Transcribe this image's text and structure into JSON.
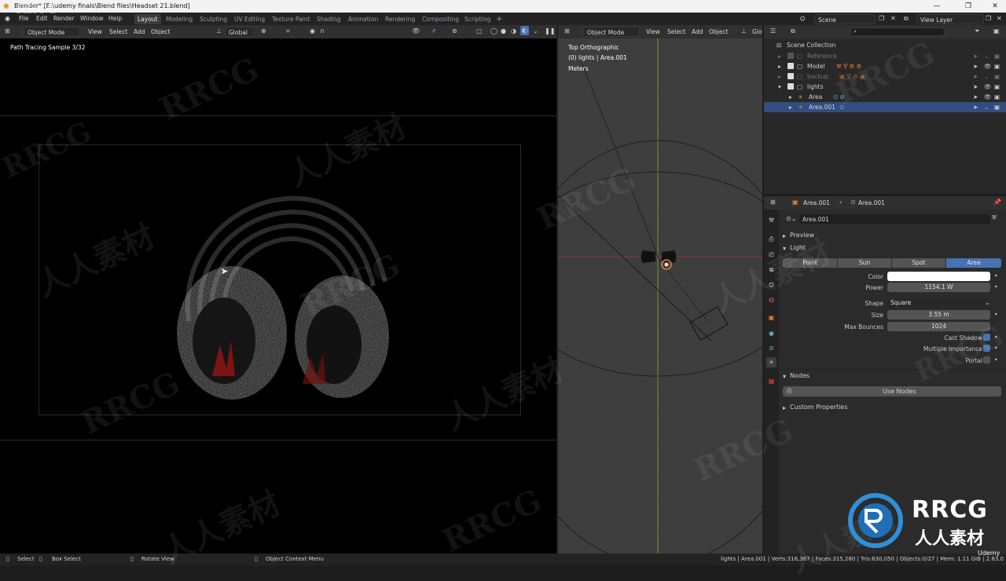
{
  "window": {
    "title": "Blender* [E:\\udemy finals\\Blend files\\Headset 21.blend]",
    "minimize": "—",
    "maximize": "❐",
    "close": "✕"
  },
  "menu": {
    "items": [
      "File",
      "Edit",
      "Render",
      "Window",
      "Help"
    ],
    "workspaces": [
      "Layout",
      "Modeling",
      "Sculpting",
      "UV Editing",
      "Texture Paint",
      "Shading",
      "Animation",
      "Rendering",
      "Compositing",
      "Scripting"
    ],
    "add_tab": "+",
    "scene_label": "Scene",
    "view_layer_label": "View Layer"
  },
  "left_viewport": {
    "mode": "Object Mode",
    "menu": [
      "View",
      "Select",
      "Add",
      "Object"
    ],
    "transform": "Global",
    "overlay_text": "Path Tracing Sample 3/32"
  },
  "right_viewport": {
    "mode": "Object Mode",
    "menu": [
      "View",
      "Select",
      "Add",
      "Object"
    ],
    "transform": "Glo",
    "view_name": "Top Orthographic",
    "collection_info": "(0) lights | Area.001",
    "units": "Meters"
  },
  "outliner": {
    "search_placeholder": "",
    "root": "Scene Collection",
    "rows": [
      {
        "label": "Reference",
        "dim": true
      },
      {
        "label": "Model",
        "dim": false
      },
      {
        "label": "backup",
        "dim": true
      },
      {
        "label": "lights",
        "dim": false
      },
      {
        "label": "Area",
        "dim": false
      },
      {
        "label": "Area.001",
        "dim": false,
        "selected": true
      }
    ]
  },
  "properties": {
    "crumb_object": "Area.001",
    "crumb_data": "Area.001",
    "datablock": "Area.001",
    "preview_panel": "Preview",
    "light_panel": "Light",
    "light_types": [
      "Point",
      "Sun",
      "Spot",
      "Area"
    ],
    "active_type": "Area",
    "color_label": "Color",
    "color_value": "#ffffff",
    "power_label": "Power",
    "power_value": "1154.1 W",
    "shape_label": "Shape",
    "shape_value": "Square",
    "size_label": "Size",
    "size_value": "3.55 m",
    "bounces_label": "Max Bounces",
    "bounces_value": "1024",
    "cast_shadow_label": "Cast Shadow",
    "cast_shadow": true,
    "mis_label": "Multiple Importance",
    "mis": true,
    "portal_label": "Portal",
    "portal": false,
    "nodes_panel": "Nodes",
    "use_nodes_label": "Use Nodes",
    "custom_props_panel": "Custom Properties"
  },
  "statusbar": {
    "select": "Select",
    "box_select": "Box Select",
    "rotate_view": "Rotate View",
    "context_menu": "Object Context Menu",
    "stats": "lights | Area.001 | Verts:316,367 | Faces:315,280 | Tris:630,050 | Objects:0/27 | Mem: 1.11 GiB | 2.83.0"
  },
  "watermarks": {
    "latin": "RRCG",
    "cjk": "人人素材",
    "brand": "RRCG",
    "brand_cjk": "人人素材",
    "udemy": "Udemy"
  },
  "colors": {
    "accent": "#4772b3",
    "selected_row": "#334d80",
    "active_tab": "#3d3d3d"
  }
}
